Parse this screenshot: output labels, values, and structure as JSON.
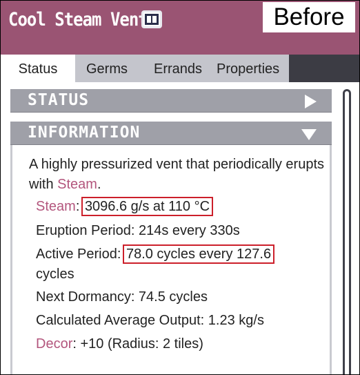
{
  "window": {
    "title": "Cool Steam Vent",
    "annotation_label": "Before"
  },
  "tabs": [
    {
      "label": "Status",
      "active": true
    },
    {
      "label": "Germs",
      "active": false
    },
    {
      "label": "Errands",
      "active": false
    },
    {
      "label": "Properties",
      "active": false
    }
  ],
  "sections": {
    "status": {
      "title": "STATUS",
      "collapsed": true
    },
    "information": {
      "title": "INFORMATION",
      "collapsed": false
    }
  },
  "info": {
    "desc_prefix": "A highly pressurized vent that periodically erupts with ",
    "desc_link": "Steam",
    "desc_suffix": ".",
    "steam_label": "Steam",
    "steam_sep": ": ",
    "steam_value": "3096.6 g/s at 110 °C",
    "eruption": "Eruption Period: 214s every 330s",
    "active_label": "Active Period: ",
    "active_value": "78.0 cycles every 127.6",
    "active_cont": "cycles",
    "dormancy": "Next Dormancy: 74.5 cycles",
    "average": "Calculated Average Output: 1.23 kg/s",
    "decor_label": "Decor",
    "decor_value": ": +10 (Radius: 2 tiles)"
  },
  "colors": {
    "title_bar": "#9a5473",
    "accent_link": "#b3567d",
    "highlight_box": "#cc1f2a",
    "section_header": "#9fa0a8"
  }
}
